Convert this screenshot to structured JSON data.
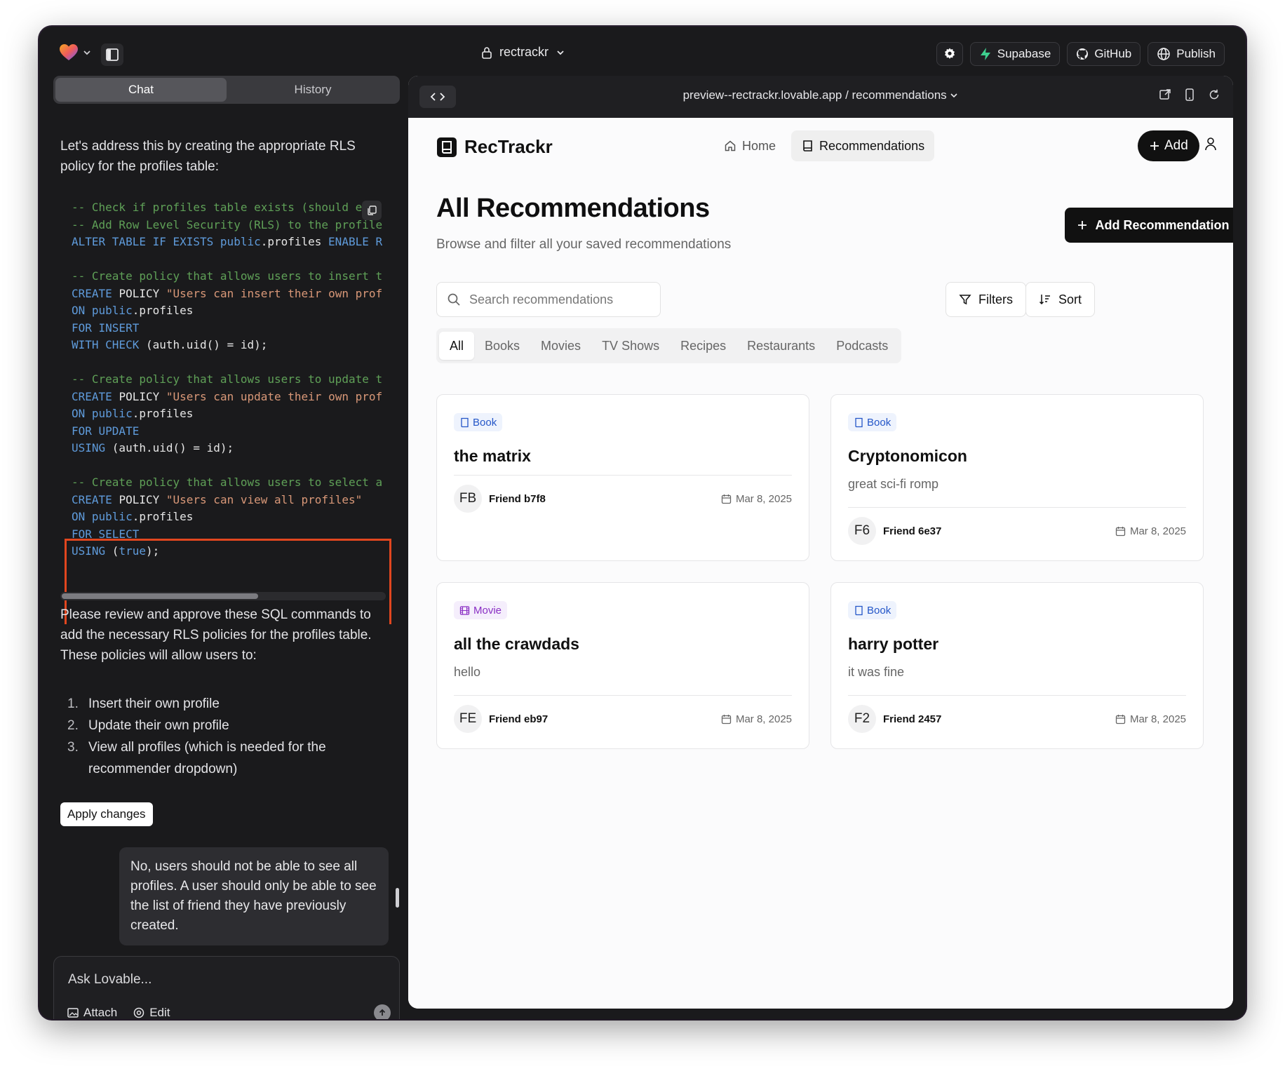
{
  "topbar": {
    "project_name": "rectrackr",
    "buttons": {
      "supabase": "Supabase",
      "github": "GitHub",
      "publish": "Publish"
    }
  },
  "chat": {
    "tabs": {
      "chat": "Chat",
      "history": "History"
    },
    "intro": "Let's address this by creating the appropriate RLS policy for the profiles table:",
    "code_lines": [
      [
        {
          "t": "comment",
          "v": "-- Check if profiles table exists (should e"
        }
      ],
      [
        {
          "t": "comment",
          "v": "-- Add Row Level Security (RLS) to the profile"
        }
      ],
      [
        {
          "t": "kw",
          "v": "ALTER TABLE IF EXISTS public"
        },
        {
          "t": "id",
          "v": ".profiles "
        },
        {
          "t": "kw",
          "v": "ENABLE R"
        }
      ],
      [],
      [
        {
          "t": "comment",
          "v": "-- Create policy that allows users to insert t"
        }
      ],
      [
        {
          "t": "kw",
          "v": "CREATE "
        },
        {
          "t": "id",
          "v": "POLICY "
        },
        {
          "t": "str",
          "v": "\"Users can insert their own prof"
        }
      ],
      [
        {
          "t": "kw",
          "v": "ON public"
        },
        {
          "t": "id",
          "v": ".profiles"
        }
      ],
      [
        {
          "t": "kw",
          "v": "FOR INSERT"
        }
      ],
      [
        {
          "t": "kw",
          "v": "WITH CHECK "
        },
        {
          "t": "id",
          "v": "(auth.uid() = id);"
        }
      ],
      [],
      [
        {
          "t": "comment",
          "v": "-- Create policy that allows users to update t"
        }
      ],
      [
        {
          "t": "kw",
          "v": "CREATE "
        },
        {
          "t": "id",
          "v": "POLICY "
        },
        {
          "t": "str",
          "v": "\"Users can update their own prof"
        }
      ],
      [
        {
          "t": "kw",
          "v": "ON public"
        },
        {
          "t": "id",
          "v": ".profiles"
        }
      ],
      [
        {
          "t": "kw",
          "v": "FOR UPDATE"
        }
      ],
      [
        {
          "t": "kw",
          "v": "USING "
        },
        {
          "t": "id",
          "v": "(auth.uid() = id);"
        }
      ],
      [],
      [
        {
          "t": "comment",
          "v": "-- Create policy that allows users to select a"
        }
      ],
      [
        {
          "t": "kw",
          "v": "CREATE "
        },
        {
          "t": "id",
          "v": "POLICY "
        },
        {
          "t": "str",
          "v": "\"Users can view all profiles\""
        }
      ],
      [
        {
          "t": "kw",
          "v": "ON public"
        },
        {
          "t": "id",
          "v": ".profiles"
        }
      ],
      [
        {
          "t": "kw",
          "v": "FOR SELECT"
        }
      ],
      [
        {
          "t": "kw",
          "v": "USING "
        },
        {
          "t": "id",
          "v": "("
        },
        {
          "t": "bool",
          "v": "true"
        },
        {
          "t": "id",
          "v": ");"
        }
      ]
    ],
    "review_text": "Please review and approve these SQL commands to add the necessary RLS policies for the profiles table. These policies will allow users to:",
    "list_items": [
      {
        "num": "1.",
        "text": "Insert their own profile"
      },
      {
        "num": "2.",
        "text": "Update their own profile"
      },
      {
        "num": "3.",
        "text": "View all profiles (which is needed for the recommender dropdown)"
      }
    ],
    "apply_button": "Apply changes",
    "user_message": "No, users should not be able to see all profiles. A user should only be able to see the list of friend they have previously created.",
    "input_placeholder": "Ask Lovable...",
    "tools": {
      "attach": "Attach",
      "edit": "Edit"
    }
  },
  "preview": {
    "url": "preview--rectrackr.lovable.app / recommendations",
    "app": {
      "brand": "RecTrackr",
      "nav": {
        "home": "Home",
        "recommendations": "Recommendations"
      },
      "add_button": "Add",
      "title": "All Recommendations",
      "subtitle": "Browse and filter all your saved recommendations",
      "add_recommendation": "Add Recommendation",
      "search_placeholder": "Search recommendations",
      "filters": "Filters",
      "sort": "Sort",
      "categories": [
        "All",
        "Books",
        "Movies",
        "TV Shows",
        "Recipes",
        "Restaurants",
        "Podcasts"
      ],
      "cards": [
        {
          "type": "Book",
          "title": "the matrix",
          "desc": "",
          "initials": "FB",
          "friend": "Friend b7f8",
          "date": "Mar 8, 2025"
        },
        {
          "type": "Book",
          "title": "Cryptonomicon",
          "desc": "great sci-fi romp",
          "initials": "F6",
          "friend": "Friend 6e37",
          "date": "Mar 8, 2025"
        },
        {
          "type": "Movie",
          "title": "all the crawdads",
          "desc": "hello",
          "initials": "FE",
          "friend": "Friend eb97",
          "date": "Mar 8, 2025"
        },
        {
          "type": "Book",
          "title": "harry potter",
          "desc": "it was fine",
          "initials": "F2",
          "friend": "Friend 2457",
          "date": "Mar 8, 2025"
        }
      ]
    }
  }
}
